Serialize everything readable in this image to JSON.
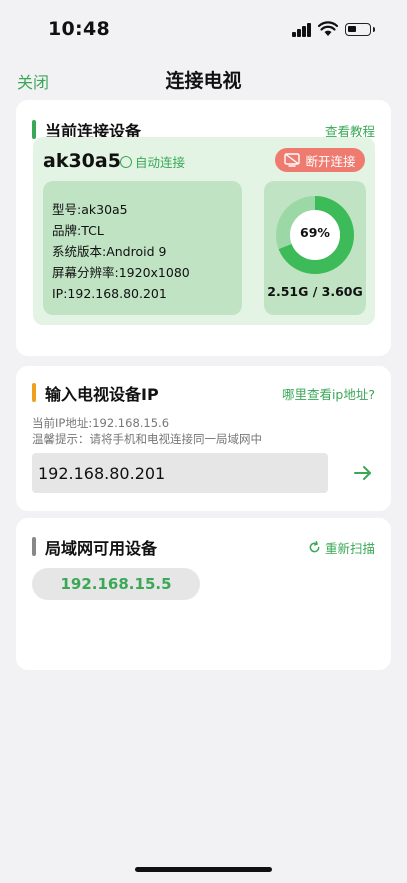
{
  "status_bar": {
    "time": "10:48"
  },
  "nav": {
    "close_label": "关闭",
    "title": "连接电视"
  },
  "current_device": {
    "section_title": "当前连接设备",
    "tutorial_link": "查看教程",
    "name": "ak30a5",
    "auto_connect_label": "自动连接",
    "disconnect_label": "断开连接",
    "info": {
      "model": "型号:ak30a5",
      "brand": "品牌:TCL",
      "system": "系统版本:Android 9",
      "resolution": "屏幕分辨率:1920x1080",
      "ip": "IP:192.168.80.201"
    },
    "memory": {
      "percent_label": "69%",
      "percent": 69,
      "usage": "2.51G / 3.60G"
    }
  },
  "ip_input": {
    "section_title": "输入电视设备IP",
    "help_link": "哪里查看ip地址?",
    "current_ip": "当前IP地址:192.168.15.6",
    "tip": "温馨提示：请将手机和电视连接同一局域网中",
    "value": "192.168.80.201"
  },
  "lan_devices": {
    "section_title": "局域网可用设备",
    "rescan_label": "重新扫描",
    "devices": [
      "192.168.15.5"
    ]
  },
  "colors": {
    "accent": "#3aa857",
    "danger": "#ef7b70",
    "panel": "#e3f3e4",
    "panel_inner": "#bfe3c3",
    "ip_bar": "#f0a020"
  }
}
